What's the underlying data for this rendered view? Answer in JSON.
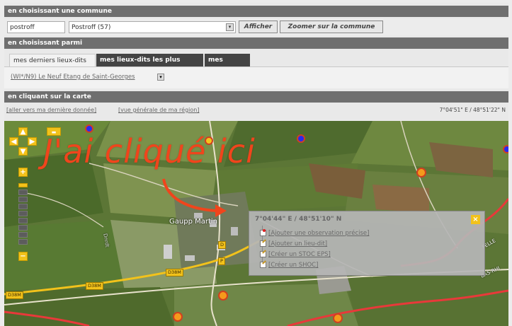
{
  "commune_section": {
    "header": "en choisissant une commune",
    "input_value": "postroff",
    "select_value": "Postroff (57)",
    "afficher_label": "Afficher",
    "zoom_label": "Zoomer sur la commune"
  },
  "parmi_section": {
    "header": "en choisissant parmi",
    "tabs": [
      "mes derniers lieux-dits",
      "mes lieux-dits les plus utilisés",
      "mes jardins"
    ],
    "selected_place": "(WI*/N9) Le Neuf Etang de Saint-Georges"
  },
  "carte_section": {
    "header": "en cliquant sur la carte",
    "link_last": "[aller vers ma dernière donnée]",
    "link_region": "[vue générale de ma région]",
    "coord_readout": "7°04'51\" E / 48°51'22\" N"
  },
  "annotation": {
    "text": "J'ai cliqué ici"
  },
  "map": {
    "place_label": "Gaupp Martin",
    "road_labels": [
      "D38M",
      "D38M",
      "D38M",
      "D",
      "P",
      "BAS-RHI",
      "FELLE"
    ],
    "place_label_small": "Dnrdt"
  },
  "popup": {
    "coord": "7°04'44\" E / 48°51'10\" N",
    "actions": [
      {
        "label": "[Ajouter une observation précise]",
        "icon": "pin-icon"
      },
      {
        "label": "[Ajouter un lieu-dit]",
        "icon": "edit-icon"
      },
      {
        "label": "[Créer un STOC EPS]",
        "icon": "edit-icon"
      },
      {
        "label": "[Créer un SHOC]",
        "icon": "edit-icon"
      }
    ]
  },
  "colors": {
    "header_bg": "#6f6f6f",
    "accent_yellow": "#f2c21b",
    "annotation_red": "#f0451c",
    "marker_orange": "#f59a1c",
    "marker_blue": "#2a2aee"
  }
}
